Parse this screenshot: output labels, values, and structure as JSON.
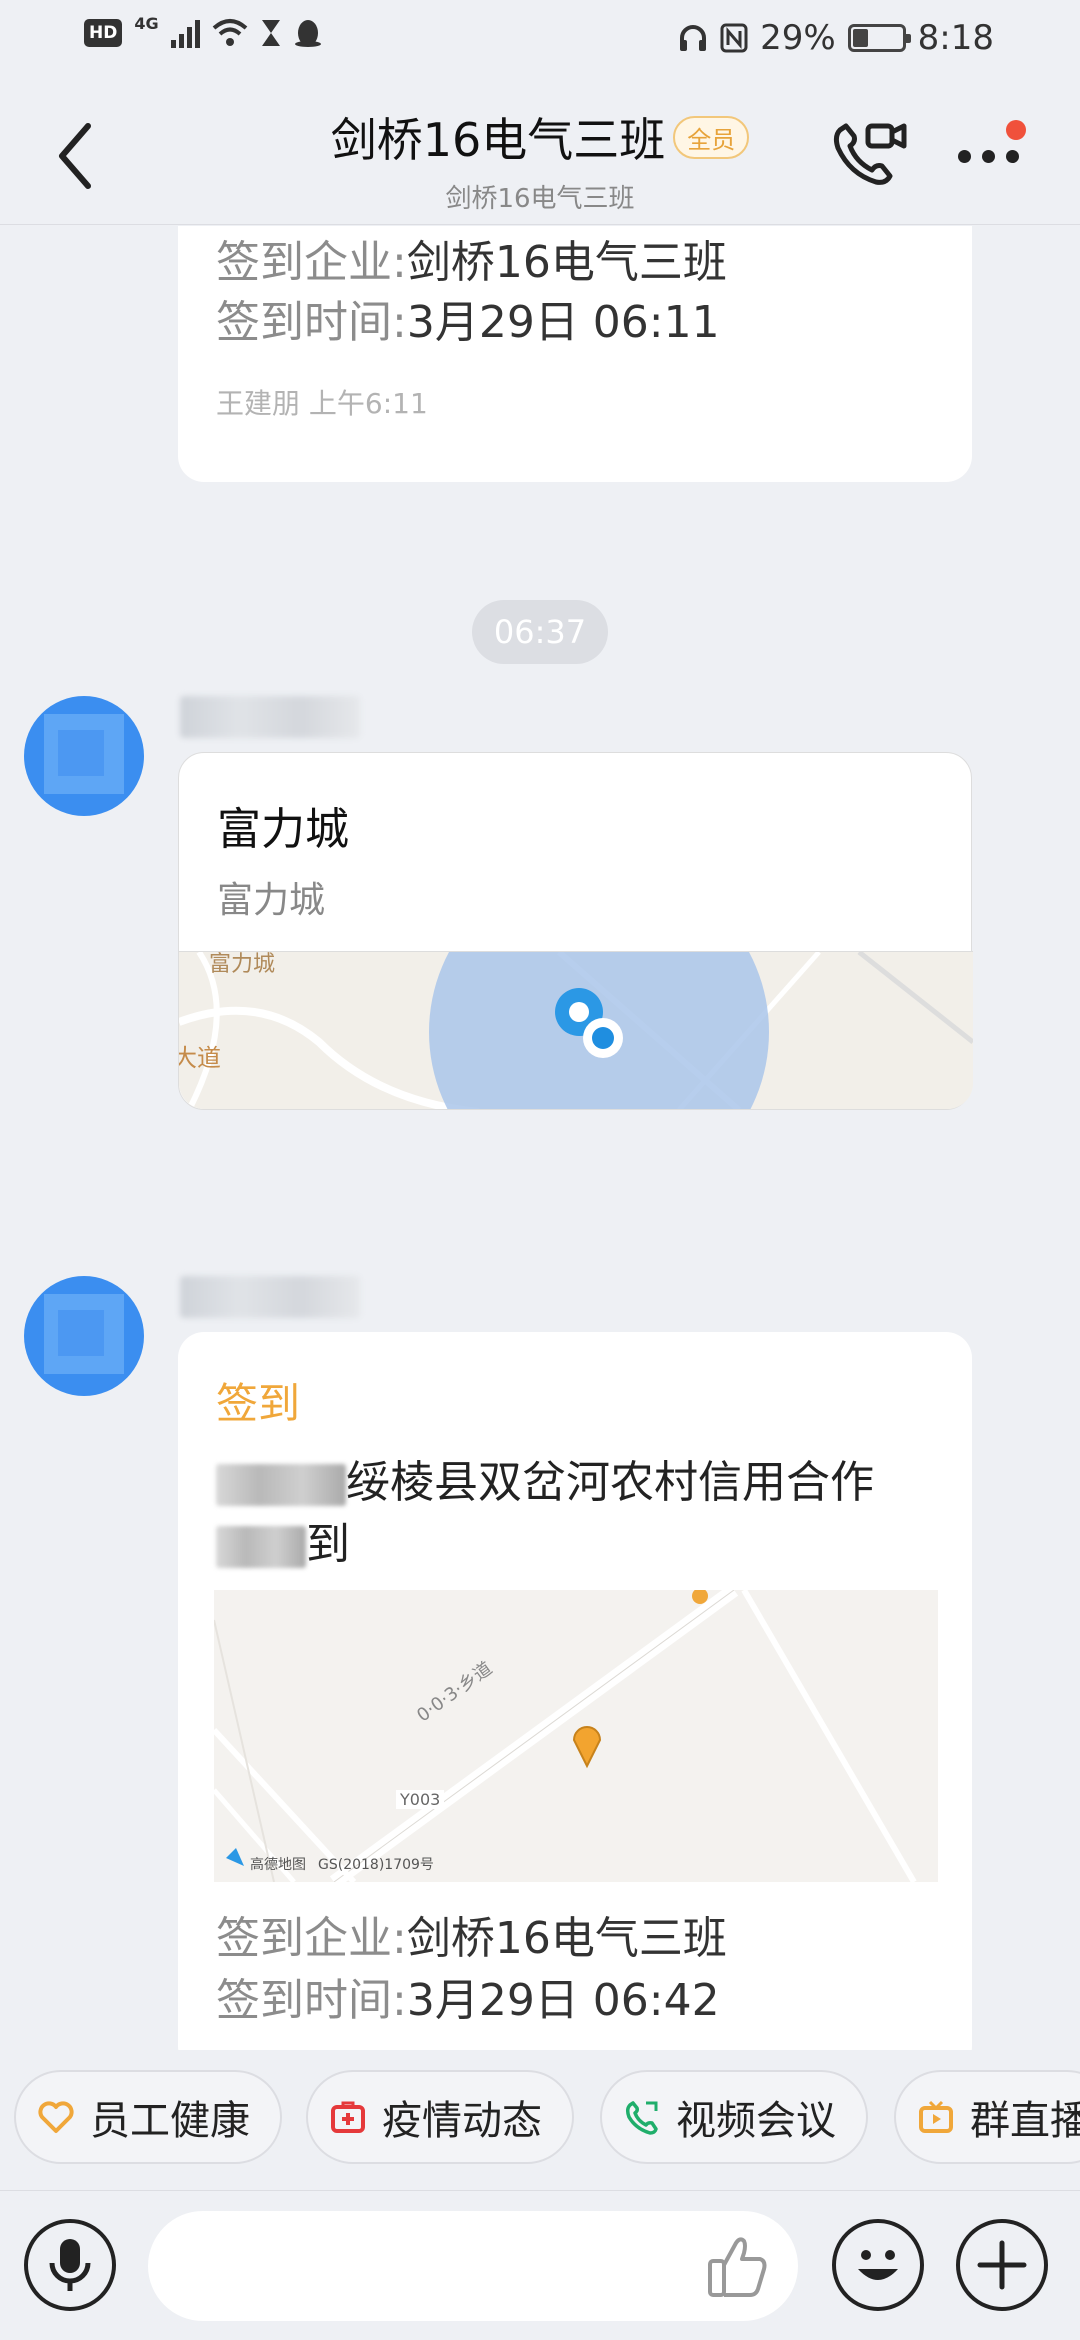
{
  "status_bar": {
    "hd": "HD",
    "network": "4G",
    "battery": "29%",
    "time": "8:18"
  },
  "header": {
    "title": "剑桥16电气三班",
    "tag": "全员",
    "subtitle": "剑桥16电气三班"
  },
  "messages": {
    "card1": {
      "company_label": "签到企业:",
      "company_value": "剑桥16电气三班",
      "time_label": "签到时间:",
      "time_value": "3月29日 06:11",
      "sender_time": "王建朋 上午6:11"
    },
    "time_divider": "06:37",
    "location": {
      "title": "富力城",
      "subtitle": "富力城",
      "map_labels": [
        "富力城",
        "大道"
      ]
    },
    "checkin": {
      "tag": "签到",
      "text_line1": "绥棱县双岔河农村信用合作",
      "text_line2": "到",
      "map_labels": [
        "0·0·3·乡道",
        "Y003",
        "高德地图",
        "GS(2018)1709号"
      ],
      "company_label": "签到企业:",
      "company_value": "剑桥16电气三班",
      "time_label": "签到时间:",
      "time_value": "3月29日 06:42"
    }
  },
  "quick_actions": [
    {
      "label": "员工健康",
      "icon": "heart-icon",
      "color": "#f0a73a"
    },
    {
      "label": "疫情动态",
      "icon": "medical-kit-icon",
      "color": "#e5393b"
    },
    {
      "label": "视频会议",
      "icon": "video-call-icon",
      "color": "#1fae6b"
    },
    {
      "label": "群直播",
      "icon": "tv-icon",
      "color": "#f0a73a"
    }
  ],
  "colors": {
    "accent_orange": "#f0a73a",
    "background": "#eef0f4",
    "notification": "#f0513b"
  }
}
